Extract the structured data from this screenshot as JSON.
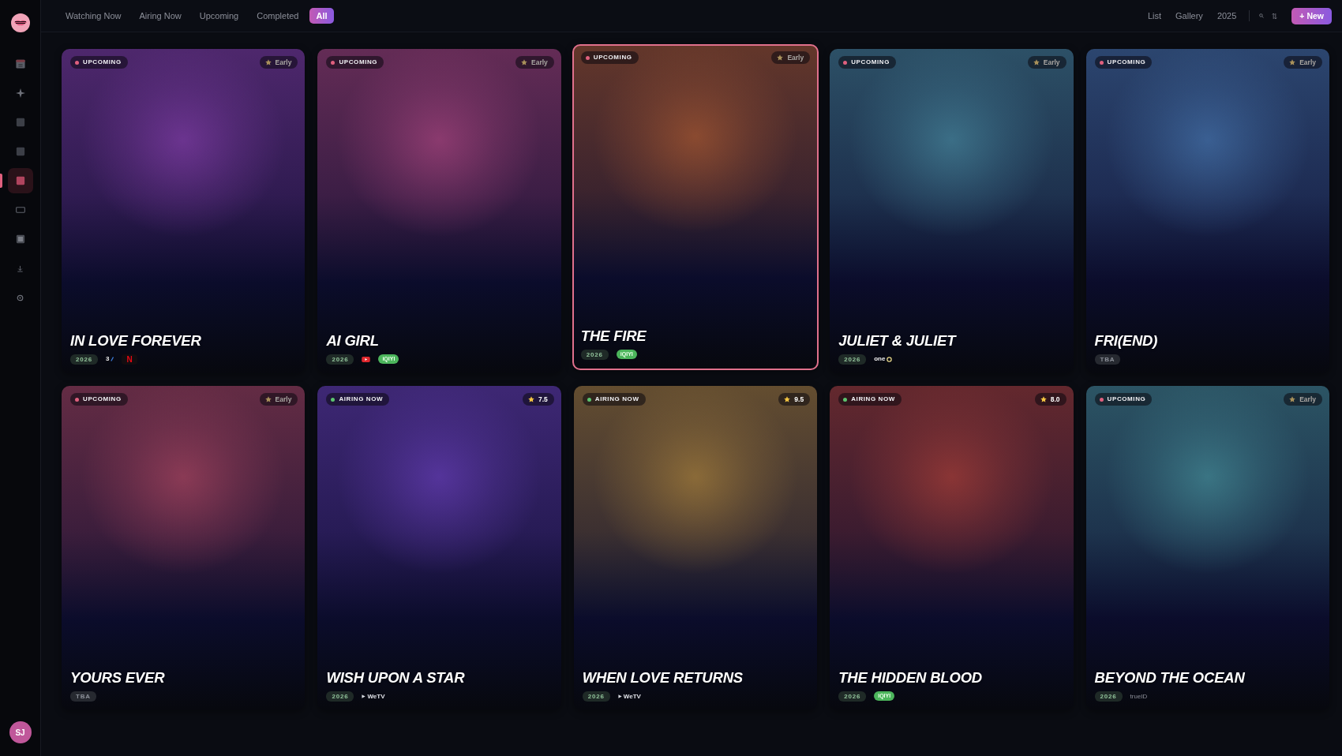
{
  "sidebar": {
    "items": [
      {
        "selected": false
      },
      {
        "selected": false
      },
      {
        "selected": false
      },
      {
        "selected": false
      },
      {
        "selected": true
      },
      {
        "selected": false
      },
      {
        "selected": false
      },
      {
        "selected": false
      },
      {
        "selected": false
      }
    ],
    "avatar": "SJ"
  },
  "topbar": {
    "tabs": [
      {
        "label": "Watching Now",
        "selected": false
      },
      {
        "label": "Airing Now",
        "selected": false
      },
      {
        "label": "Upcoming",
        "selected": false
      },
      {
        "label": "Completed",
        "selected": false
      },
      {
        "label": "All",
        "selected": true
      }
    ],
    "views": [
      {
        "label": "List"
      },
      {
        "label": "Gallery"
      }
    ],
    "year_filter": "2025",
    "new_button": "+ New"
  },
  "cards": [
    {
      "title": "IN LOVE FOREVER",
      "color": "#6b348f",
      "selected": false,
      "status": {
        "label": "UPCOMING",
        "color": "#e0607e"
      },
      "badge": {
        "kind": "early",
        "label": "Early"
      },
      "year": {
        "kind": "year",
        "label": "2026"
      },
      "platforms": [
        {
          "kind": "accent-mark",
          "label": "3"
        },
        {
          "kind": "red-mark",
          "label": "N"
        }
      ]
    },
    {
      "title": "AI GIRL",
      "color": "#8a3a6e",
      "selected": false,
      "status": {
        "label": "UPCOMING",
        "color": "#e0607e"
      },
      "badge": {
        "kind": "early",
        "label": "Early"
      },
      "year": {
        "kind": "year",
        "label": "2026"
      },
      "platforms": [
        {
          "kind": "video-icon"
        },
        {
          "kind": "chip",
          "label": "iQIYI"
        }
      ]
    },
    {
      "title": "THE FIRE",
      "color": "#8a4a30",
      "selected": true,
      "status": {
        "label": "UPCOMING",
        "color": "#e0607e"
      },
      "badge": {
        "kind": "early",
        "label": "Early"
      },
      "year": {
        "kind": "year",
        "label": "2026"
      },
      "platforms": [
        {
          "kind": "chip",
          "label": "iQIYI"
        }
      ]
    },
    {
      "title": "JULIET & JULIET",
      "color": "#3b6e86",
      "selected": false,
      "status": {
        "label": "UPCOMING",
        "color": "#e0607e"
      },
      "badge": {
        "kind": "early",
        "label": "Early"
      },
      "year": {
        "kind": "year",
        "label": "2026"
      },
      "platforms": [
        {
          "kind": "ring-mark",
          "label": "one"
        }
      ]
    },
    {
      "title": "FRI(END)",
      "color": "#3a5f92",
      "selected": false,
      "status": {
        "label": "UPCOMING",
        "color": "#e0607e"
      },
      "badge": {
        "kind": "early",
        "label": "Early"
      },
      "year": {
        "kind": "tba",
        "label": "TBA"
      }
    },
    {
      "title": "YOURS EVER",
      "color": "#8a3a55",
      "selected": false,
      "status": {
        "label": "UPCOMING",
        "color": "#e0607e"
      },
      "badge": {
        "kind": "early",
        "label": "Early"
      },
      "year": {
        "kind": "tba",
        "label": "TBA"
      }
    },
    {
      "title": "WISH UPON A STAR",
      "color": "#54349a",
      "selected": false,
      "status": {
        "label": "AIRING NOW",
        "color": "#5cc46f"
      },
      "badge": {
        "kind": "score",
        "label": "7.5"
      },
      "year": {
        "kind": "year",
        "label": "2026"
      },
      "platforms": [
        {
          "kind": "play-mark",
          "label": "WeTV"
        }
      ]
    },
    {
      "title": "WHEN LOVE RETURNS",
      "color": "#8a6a38",
      "selected": false,
      "status": {
        "label": "AIRING NOW",
        "color": "#5cc46f"
      },
      "badge": {
        "kind": "score",
        "label": "9.5"
      },
      "year": {
        "kind": "year",
        "label": "2026"
      },
      "platforms": [
        {
          "kind": "play-mark",
          "label": "WeTV"
        }
      ]
    },
    {
      "title": "THE HIDDEN BLOOD",
      "color": "#8a3535",
      "selected": false,
      "status": {
        "label": "AIRING NOW",
        "color": "#5cc46f"
      },
      "badge": {
        "kind": "score",
        "label": "8.0"
      },
      "year": {
        "kind": "year",
        "label": "2026"
      },
      "platforms": [
        {
          "kind": "chip",
          "label": "iQIYI"
        }
      ]
    },
    {
      "title": "BEYOND THE OCEAN",
      "color": "#3a7483",
      "selected": false,
      "status": {
        "label": "UPCOMING",
        "color": "#e0607e"
      },
      "badge": {
        "kind": "early",
        "label": "Early"
      },
      "year": {
        "kind": "year",
        "label": "2026"
      },
      "platforms": [
        {
          "kind": "dim-mark",
          "label": "trueID"
        }
      ]
    }
  ]
}
